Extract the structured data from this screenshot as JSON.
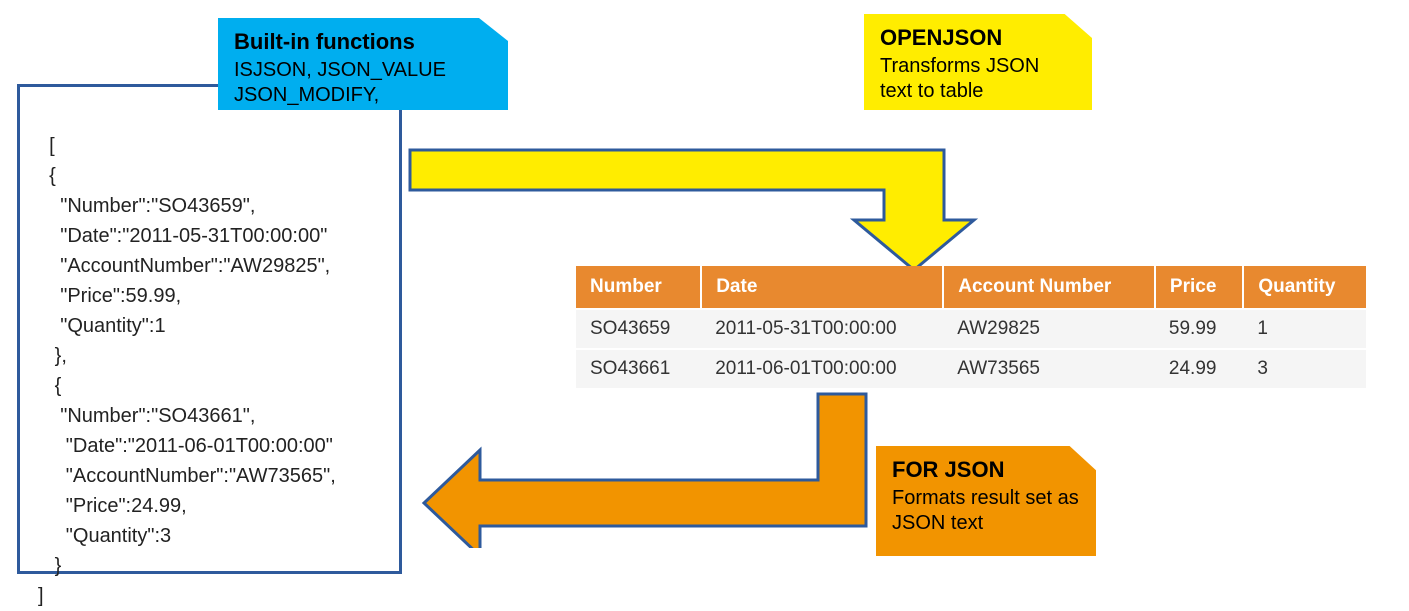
{
  "builtin_callout": {
    "title": "Built-in functions",
    "line1": "ISJSON, JSON_VALUE",
    "line2": "JSON_MODIFY, JSON_QUERY"
  },
  "openjson_callout": {
    "title": "OPENJSON",
    "desc": "Transforms JSON text to table"
  },
  "forjson_callout": {
    "title": "FOR JSON",
    "desc": "Formats result set as JSON text"
  },
  "json_text": "[\n  {\n    \"Number\":\"SO43659\",\n    \"Date\":\"2011-05-31T00:00:00\"\n    \"AccountNumber\":\"AW29825\",\n    \"Price\":59.99,\n    \"Quantity\":1\n   },\n   {\n    \"Number\":\"SO43661\",\n     \"Date\":\"2011-06-01T00:00:00\"\n     \"AccountNumber\":\"AW73565\",\n     \"Price\":24.99,\n     \"Quantity\":3\n   }\n]",
  "table": {
    "headers": [
      "Number",
      "Date",
      "Account Number",
      "Price",
      "Quantity"
    ],
    "rows": [
      [
        "SO43659",
        "2011-05-31T00:00:00",
        "AW29825",
        "59.99",
        "1"
      ],
      [
        "SO43661",
        "2011-06-01T00:00:00",
        "AW73565",
        "24.99",
        "3"
      ]
    ]
  },
  "chart_data": {
    "type": "table",
    "title": "",
    "columns": [
      "Number",
      "Date",
      "Account Number",
      "Price",
      "Quantity"
    ],
    "rows": [
      {
        "Number": "SO43659",
        "Date": "2011-05-31T00:00:00",
        "Account Number": "AW29825",
        "Price": 59.99,
        "Quantity": 1
      },
      {
        "Number": "SO43661",
        "Date": "2011-06-01T00:00:00",
        "Account Number": "AW73565",
        "Price": 24.99,
        "Quantity": 3
      }
    ]
  }
}
